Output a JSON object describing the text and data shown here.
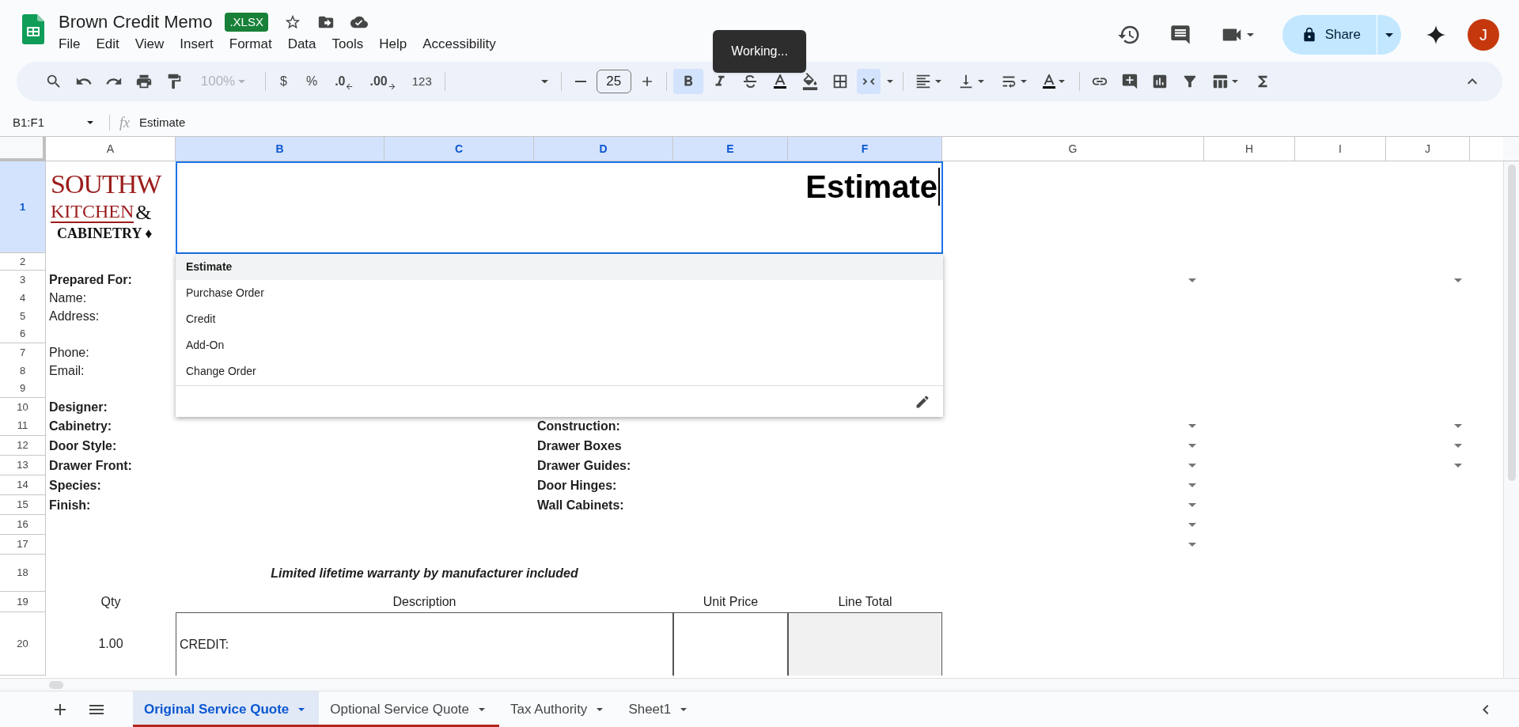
{
  "document": {
    "title": "Brown Credit Memo",
    "badge": ".XLSX"
  },
  "menu": [
    "File",
    "Edit",
    "View",
    "Insert",
    "Format",
    "Data",
    "Tools",
    "Help",
    "Accessibility"
  ],
  "share": {
    "label": "Share"
  },
  "avatar": {
    "initial": "J"
  },
  "toast": {
    "text": "Working..."
  },
  "toolbar": {
    "zoom": "100%",
    "currency": "$",
    "percent": "%",
    "decrease_decimals": ".0",
    "increase_decimals": ".00",
    "number_format": "123",
    "font_size": "25",
    "bold_on": true,
    "merge_on": true
  },
  "formula_bar": {
    "name_box": "B1:F1",
    "fx_label": "fx",
    "formula": "Estimate"
  },
  "sheet": {
    "columns": [
      {
        "label": "A",
        "selected": false
      },
      {
        "label": "B",
        "selected": true
      },
      {
        "label": "C",
        "selected": true
      },
      {
        "label": "D",
        "selected": true
      },
      {
        "label": "E",
        "selected": true
      },
      {
        "label": "F",
        "selected": true
      },
      {
        "label": "G",
        "selected": false
      },
      {
        "label": "H",
        "selected": false
      },
      {
        "label": "I",
        "selected": false
      },
      {
        "label": "J",
        "selected": false
      }
    ],
    "rows": [
      {
        "number": "1",
        "selected": true,
        "logo": {
          "line_1": "SOUTHW",
          "line_2": "KITCHEN",
          "line_2_mark": "&",
          "line_3": "CABINETRY ♦"
        }
      },
      {
        "number": "2",
        "selected": false
      },
      {
        "number": "3",
        "selected": false,
        "A": {
          "text": "Prepared For:",
          "bold": true
        },
        "g_dropdown": true,
        "j_dropdown": true
      },
      {
        "number": "4",
        "selected": false,
        "A": {
          "text": "Name:",
          "bold": false
        }
      },
      {
        "number": "5",
        "selected": false,
        "A": {
          "text": "Address:",
          "bold": false
        }
      },
      {
        "number": "6",
        "selected": false
      },
      {
        "number": "7",
        "selected": false,
        "A": {
          "text": "Phone:",
          "bold": false
        }
      },
      {
        "number": "8",
        "selected": false,
        "A": {
          "text": "Email:",
          "bold": false
        }
      },
      {
        "number": "9",
        "selected": false
      },
      {
        "number": "10",
        "selected": false,
        "A": {
          "text": "Designer:",
          "bold": true
        }
      },
      {
        "number": "11",
        "selected": false,
        "A": {
          "text": "Cabinetry:",
          "bold": true
        },
        "D": {
          "text": "Construction:",
          "bold": true
        },
        "g_dropdown": true,
        "j_dropdown": true
      },
      {
        "number": "12",
        "selected": false,
        "A": {
          "text": "Door Style:",
          "bold": true
        },
        "D": {
          "text": "Drawer Boxes",
          "bold": true
        },
        "g_dropdown": true,
        "j_dropdown": true
      },
      {
        "number": "13",
        "selected": false,
        "A": {
          "text": "Drawer Front:",
          "bold": true
        },
        "D": {
          "text": "Drawer Guides:",
          "bold": true
        },
        "g_dropdown": true,
        "j_dropdown": true
      },
      {
        "number": "14",
        "selected": false,
        "A": {
          "text": "Species:",
          "bold": true
        },
        "D": {
          "text": "Door Hinges:",
          "bold": true
        },
        "g_dropdown": true
      },
      {
        "number": "15",
        "selected": false,
        "A": {
          "text": "Finish:",
          "bold": true
        },
        "D": {
          "text": "Wall Cabinets:",
          "bold": true
        },
        "g_dropdown": true
      },
      {
        "number": "16",
        "selected": false,
        "g_dropdown": true
      },
      {
        "number": "17",
        "selected": false,
        "g_dropdown": true
      },
      {
        "number": "18",
        "selected": false,
        "B": {
          "text": "Limited lifetime warranty by manufacturer included",
          "bold": true,
          "italic": true,
          "merged": true,
          "centered": true
        }
      },
      {
        "number": "19",
        "selected": false,
        "A": {
          "text": "Qty",
          "bold": false,
          "centered": true
        },
        "B": {
          "text": "Description",
          "bold": false,
          "merged": true,
          "centered": true
        },
        "E": {
          "text": "Unit Price",
          "bold": false,
          "centered": true
        },
        "F": {
          "text": "Line Total",
          "bold": false,
          "centered": true
        }
      },
      {
        "number": "20",
        "selected": false,
        "A": {
          "text": "1.00",
          "bold": false,
          "centered": true
        },
        "B": {
          "text": "CREDIT:",
          "bold": false,
          "merged": true,
          "bordered": true
        },
        "E": {
          "bordered": true
        },
        "F": {
          "bordered": true,
          "shaded": true
        }
      }
    ],
    "editor": {
      "value": "Estimate",
      "options": [
        {
          "label": "Estimate",
          "selected": true
        },
        {
          "label": "Purchase Order",
          "selected": false
        },
        {
          "label": "Credit",
          "selected": false
        },
        {
          "label": "Add-On",
          "selected": false
        },
        {
          "label": "Change Order",
          "selected": false
        }
      ]
    }
  },
  "sheet_tabs": [
    {
      "label": "Original Service Quote",
      "selected": true,
      "color": "#b3261e"
    },
    {
      "label": "Optional Service Quote",
      "selected": false,
      "color": "#b3261e"
    },
    {
      "label": "Tax Authority",
      "selected": false
    },
    {
      "label": "Sheet1",
      "selected": false
    }
  ]
}
